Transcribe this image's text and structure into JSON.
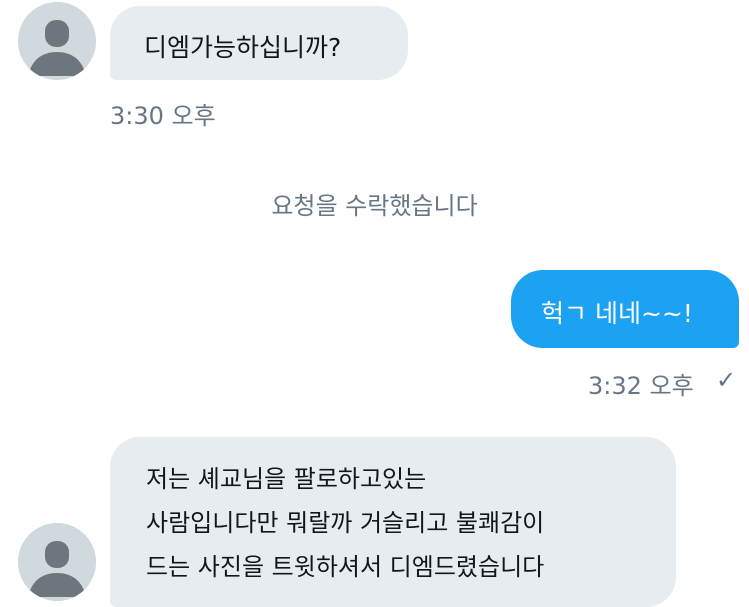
{
  "messages": {
    "first_in": {
      "text": "디엠가능하십니까?",
      "time": "3:30 오후"
    },
    "system_notice": "요청을 수락했습니다",
    "out": {
      "text": "헉ㄱ 네네~~!",
      "time": "3:32 오후",
      "status_icon": "check-icon"
    },
    "second_in": {
      "lines": [
        "저는 셰교님을 팔로하고있는",
        "사람입니다만 뭐랄까 거슬리고 불쾌감이",
        "드는 사진을 트윗하셔서 디엠드렸습니다"
      ]
    }
  },
  "colors": {
    "incoming_bubble": "#e6ecf0",
    "outgoing_bubble": "#1da1f2",
    "meta_text": "#657786",
    "avatar": "#cfd9de"
  }
}
